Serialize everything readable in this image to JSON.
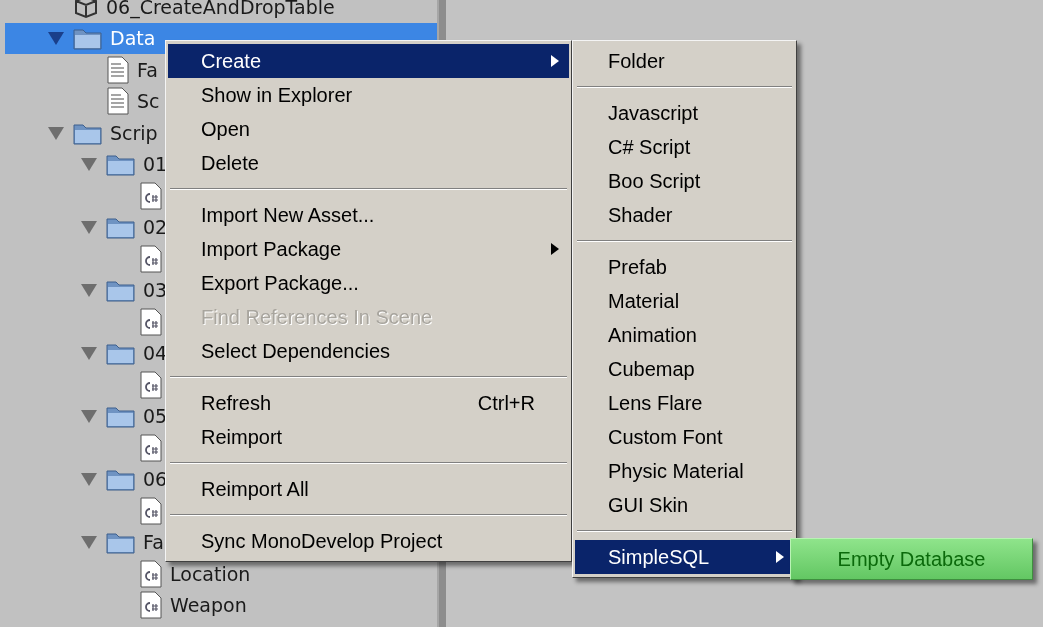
{
  "tree": [
    {
      "label": "06_CreateAndDropTable",
      "kind": "scene",
      "selected": false
    },
    {
      "label": "Data",
      "kind": "folder",
      "expanded": true,
      "selected": true,
      "children": [
        {
          "label": "Fa",
          "kind": "text",
          "selected": false
        },
        {
          "label": "Sc",
          "kind": "text",
          "selected": false
        }
      ]
    },
    {
      "label": "Scrip",
      "kind": "folder",
      "expanded": true,
      "selected": false,
      "children": [
        {
          "label": "01",
          "kind": "folder",
          "expanded": true,
          "selected": false,
          "children": [
            {
              "kind": "script",
              "selected": false
            }
          ]
        },
        {
          "label": "02",
          "kind": "folder",
          "expanded": true,
          "selected": false,
          "children": [
            {
              "kind": "script",
              "selected": false
            }
          ]
        },
        {
          "label": "03",
          "kind": "folder",
          "expanded": true,
          "selected": false,
          "children": [
            {
              "kind": "script",
              "selected": false
            }
          ]
        },
        {
          "label": "04",
          "kind": "folder",
          "expanded": true,
          "selected": false,
          "children": [
            {
              "kind": "script",
              "selected": false
            }
          ]
        },
        {
          "label": "05",
          "kind": "folder",
          "expanded": true,
          "selected": false,
          "children": [
            {
              "kind": "script",
              "selected": false
            }
          ]
        },
        {
          "label": "06",
          "kind": "folder",
          "expanded": true,
          "selected": false,
          "children": [
            {
              "kind": "script",
              "selected": false
            }
          ]
        },
        {
          "label": "Fa",
          "kind": "folder",
          "expanded": true,
          "selected": false,
          "children": [
            {
              "label": "Location",
              "kind": "script",
              "selected": false
            },
            {
              "label": "Weapon",
              "kind": "script",
              "selected": false
            }
          ]
        }
      ]
    }
  ],
  "context_menu": [
    {
      "kind": "item",
      "label": "Create",
      "selected": true,
      "disabled": false,
      "submenu": true
    },
    {
      "kind": "item",
      "label": "Show in Explorer",
      "selected": false,
      "disabled": false,
      "submenu": false
    },
    {
      "kind": "item",
      "label": "Open",
      "selected": false,
      "disabled": false,
      "submenu": false
    },
    {
      "kind": "item",
      "label": "Delete",
      "selected": false,
      "disabled": false,
      "submenu": false
    },
    {
      "kind": "separator"
    },
    {
      "kind": "item",
      "label": "Import New Asset...",
      "selected": false,
      "disabled": false,
      "submenu": false
    },
    {
      "kind": "item",
      "label": "Import Package",
      "selected": false,
      "disabled": false,
      "submenu": true
    },
    {
      "kind": "item",
      "label": "Export Package...",
      "selected": false,
      "disabled": false,
      "submenu": false
    },
    {
      "kind": "item",
      "label": "Find References In Scene",
      "selected": false,
      "disabled": true,
      "submenu": false
    },
    {
      "kind": "item",
      "label": "Select Dependencies",
      "selected": false,
      "disabled": false,
      "submenu": false
    },
    {
      "kind": "separator"
    },
    {
      "kind": "item",
      "label": "Refresh",
      "shortcut": "Ctrl+R",
      "selected": false,
      "disabled": false,
      "submenu": false
    },
    {
      "kind": "item",
      "label": "Reimport",
      "selected": false,
      "disabled": false,
      "submenu": false
    },
    {
      "kind": "separator"
    },
    {
      "kind": "item",
      "label": "Reimport All",
      "selected": false,
      "disabled": false,
      "submenu": false
    },
    {
      "kind": "separator"
    },
    {
      "kind": "item",
      "label": "Sync MonoDevelop Project",
      "selected": false,
      "disabled": false,
      "submenu": false
    }
  ],
  "create_submenu": [
    {
      "kind": "item",
      "label": "Folder",
      "selected": false,
      "submenu": false
    },
    {
      "kind": "separator"
    },
    {
      "kind": "item",
      "label": "Javascript",
      "selected": false,
      "submenu": false
    },
    {
      "kind": "item",
      "label": "C# Script",
      "selected": false,
      "submenu": false
    },
    {
      "kind": "item",
      "label": "Boo Script",
      "selected": false,
      "submenu": false
    },
    {
      "kind": "item",
      "label": "Shader",
      "selected": false,
      "submenu": false
    },
    {
      "kind": "separator"
    },
    {
      "kind": "item",
      "label": "Prefab",
      "selected": false,
      "submenu": false
    },
    {
      "kind": "item",
      "label": "Material",
      "selected": false,
      "submenu": false
    },
    {
      "kind": "item",
      "label": "Animation",
      "selected": false,
      "submenu": false
    },
    {
      "kind": "item",
      "label": "Cubemap",
      "selected": false,
      "submenu": false
    },
    {
      "kind": "item",
      "label": "Lens Flare",
      "selected": false,
      "submenu": false
    },
    {
      "kind": "item",
      "label": "Custom Font",
      "selected": false,
      "submenu": false
    },
    {
      "kind": "item",
      "label": "Physic Material",
      "selected": false,
      "submenu": false
    },
    {
      "kind": "item",
      "label": "GUI Skin",
      "selected": false,
      "submenu": false
    },
    {
      "kind": "separator"
    },
    {
      "kind": "item",
      "label": "SimpleSQL",
      "selected": true,
      "submenu": true
    }
  ],
  "simplesql_submenu": [
    {
      "label": "Empty Database",
      "selected": true
    }
  ]
}
